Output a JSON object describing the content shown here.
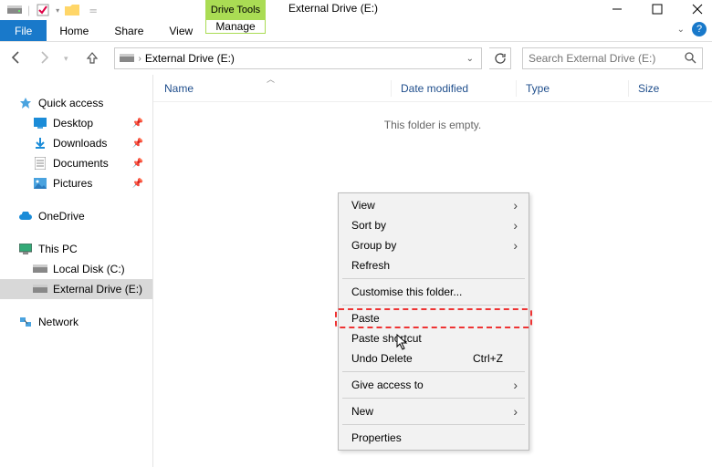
{
  "title": "External Drive (E:)",
  "tools_tab": "Drive Tools",
  "ribbon": {
    "file": "File",
    "home": "Home",
    "share": "Share",
    "view": "View",
    "manage": "Manage"
  },
  "address": {
    "text": "External Drive (E:)"
  },
  "search": {
    "placeholder": "Search External Drive (E:)"
  },
  "sidebar": {
    "quick_access": "Quick access",
    "desktop": "Desktop",
    "downloads": "Downloads",
    "documents": "Documents",
    "pictures": "Pictures",
    "onedrive": "OneDrive",
    "this_pc": "This PC",
    "local_disk": "Local Disk (C:)",
    "external": "External Drive (E:)",
    "network": "Network"
  },
  "columns": {
    "name": "Name",
    "date": "Date modified",
    "type": "Type",
    "size": "Size"
  },
  "empty": "This folder is empty.",
  "context_menu": {
    "view": "View",
    "sort": "Sort by",
    "group": "Group by",
    "refresh": "Refresh",
    "customise": "Customise this folder...",
    "paste": "Paste",
    "paste_shortcut": "Paste shortcut",
    "undo_delete": "Undo Delete",
    "undo_key": "Ctrl+Z",
    "give_access": "Give access to",
    "new": "New",
    "properties": "Properties"
  }
}
